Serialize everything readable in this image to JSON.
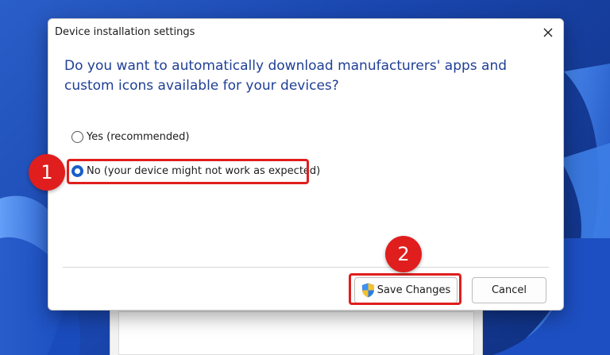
{
  "dialog": {
    "title": "Device installation settings",
    "question": "Do you want to automatically download manufacturers' apps and custom icons available for your devices?",
    "options": [
      {
        "label": "Yes (recommended)",
        "checked": false
      },
      {
        "label": "No (your device might not work as expected)",
        "checked": true
      }
    ],
    "buttons": {
      "save_label": "Save Changes",
      "cancel_label": "Cancel"
    }
  },
  "annotations": {
    "step1": "1",
    "step2": "2",
    "color": "#e01e1e"
  },
  "colors": {
    "question_text": "#1f3f96",
    "radio_selected": "#1a5fc9"
  },
  "icons": {
    "close": "close-icon",
    "save": "uac-shield-icon"
  }
}
